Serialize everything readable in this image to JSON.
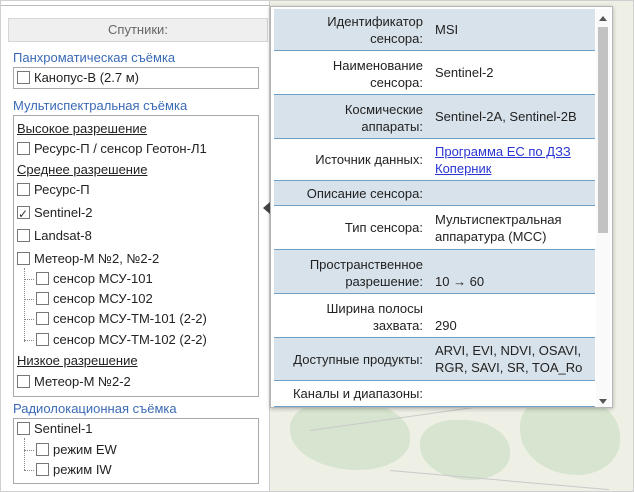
{
  "sidebar": {
    "header": "Спутники:",
    "sections": {
      "pan": {
        "title": "Панхроматическая съёмка",
        "items": [
          {
            "label": "Канопус-В (2.7 м)",
            "checked": false
          }
        ]
      },
      "multi": {
        "title": "Мультиспектральная съёмка",
        "groups": {
          "high": "Высокое разрешение",
          "medium": "Среднее разрешение",
          "low": "Низкое разрешение"
        },
        "items": {
          "resurs_geoton": {
            "label": "Ресурс-П / сенсор Геотон-Л1",
            "checked": false
          },
          "resurs_p": {
            "label": "Ресурс-П",
            "checked": false
          },
          "sentinel2": {
            "label": "Sentinel-2",
            "checked": true
          },
          "landsat8": {
            "label": "Landsat-8",
            "checked": false
          },
          "meteor": {
            "label": "Метеор-М №2, №2-2",
            "checked": false
          },
          "msu101": {
            "label": "сенсор МСУ-101",
            "checked": false
          },
          "msu102": {
            "label": "сенсор МСУ-102",
            "checked": false
          },
          "msutm101": {
            "label": "сенсор МСУ-ТМ-101 (2-2)",
            "checked": false
          },
          "msutm102": {
            "label": "сенсор МСУ-ТМ-102 (2-2)",
            "checked": false
          },
          "meteor22": {
            "label": "Метеор-М №2-2",
            "checked": false
          }
        }
      },
      "radar": {
        "title": "Радиолокационная съёмка",
        "items": {
          "sentinel1": {
            "label": "Sentinel-1",
            "checked": false
          },
          "ew": {
            "label": "режим EW",
            "checked": false
          },
          "iw": {
            "label": "режим IW",
            "checked": false
          }
        }
      }
    }
  },
  "popup": {
    "rows": [
      {
        "key": "Идентификатор сенсора:",
        "value": "MSI",
        "shaded": true
      },
      {
        "key": "Наименование сенсора:",
        "value": "Sentinel-2",
        "shaded": false
      },
      {
        "key": "Космические аппараты:",
        "value": "Sentinel-2A, Sentinel-2B",
        "shaded": true
      },
      {
        "key": "Источник данных:",
        "value": "Программа ЕС по ДЗЗ Коперник",
        "shaded": false,
        "link": true
      },
      {
        "key": "Описание сенсора:",
        "value": "",
        "shaded": true
      },
      {
        "key": "Тип сенсора:",
        "value": "Мультиспектральная аппаратура (МСС)",
        "shaded": false
      },
      {
        "key": "Пространственное разрешение:",
        "value": "10 → 60",
        "shaded": true
      },
      {
        "key": "Ширина полосы захвата:",
        "value": "290",
        "shaded": false
      },
      {
        "key": "Доступные продукты:",
        "value": "ARVI, EVI, NDVI, OSAVI, RGR, SAVI, SR, TOA_Ro",
        "shaded": true
      },
      {
        "key": "Каналы и диапазоны:",
        "value": "",
        "shaded": false
      }
    ]
  },
  "colors": {
    "section_title": "#3a6ab5",
    "row_shade": "#d7e2ea",
    "row_border": "#6fa0c8",
    "link": "#2a36d1"
  }
}
